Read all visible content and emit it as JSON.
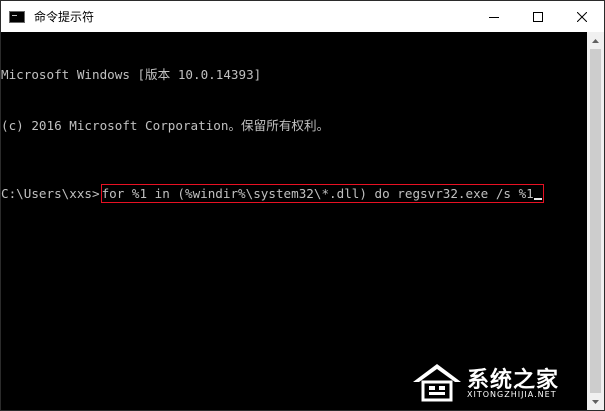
{
  "window": {
    "title": "命令提示符",
    "controls": {
      "minimize_icon": "minimize-icon",
      "maximize_icon": "maximize-icon",
      "close_icon": "close-icon"
    }
  },
  "terminal": {
    "lines": [
      "Microsoft Windows [版本 10.0.14393]",
      "(c) 2016 Microsoft Corporation。保留所有权利。"
    ],
    "prompt": "C:\\Users\\xxs>",
    "command": "for %1 in (%windir%\\system32\\*.dll) do regsvr32.exe /s %1"
  },
  "watermark": {
    "text": "系统之家",
    "subtext": "XITONGZHIJIA.NET"
  },
  "colors": {
    "highlight_box": "#e81123",
    "console_bg": "#000000",
    "console_fg": "#c0c0c0"
  }
}
